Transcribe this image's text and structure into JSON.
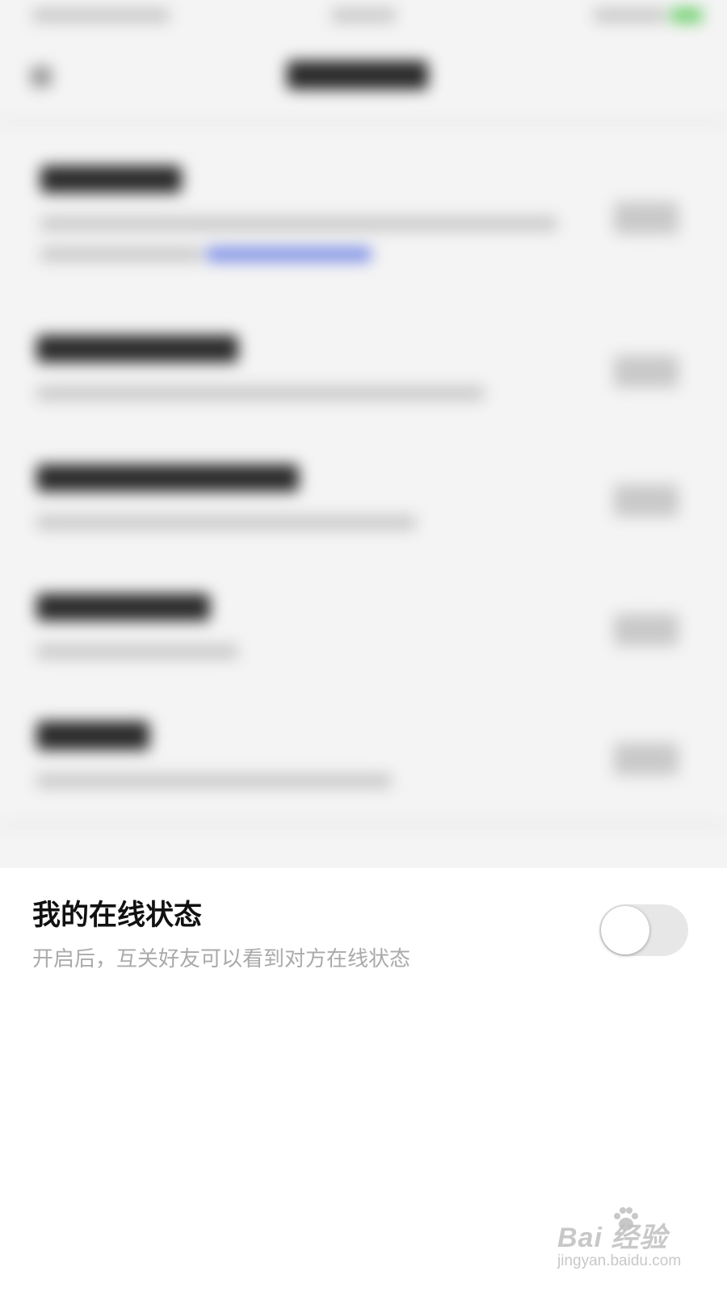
{
  "online_status_setting": {
    "title": "我的在线状态",
    "description": "开启后，互关好友可以看到对方在线状态",
    "toggle_on": false
  },
  "watermark": {
    "logo_text": "Bai  经验",
    "url": "jingyan.baidu.com"
  },
  "colors": {
    "title_text": "#111111",
    "description_text": "#aaaaaa",
    "toggle_track_off": "#e7e7e7",
    "toggle_knob": "#ffffff"
  },
  "icons": {
    "watermark_paw": "paw-icon"
  }
}
